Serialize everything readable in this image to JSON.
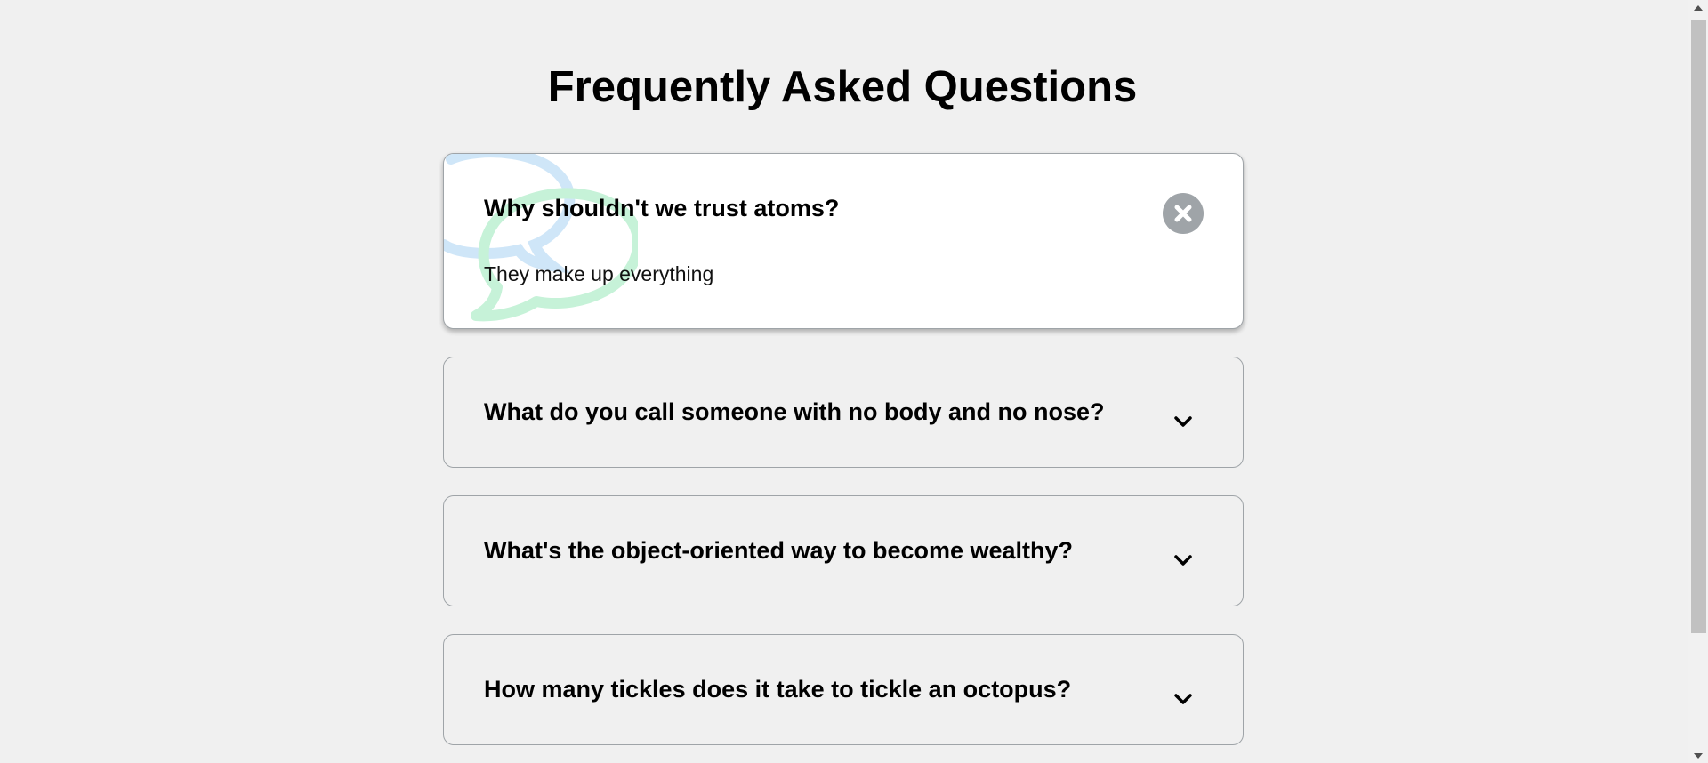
{
  "page": {
    "title": "Frequently Asked Questions"
  },
  "faqs": [
    {
      "question": "Why shouldn't we trust atoms?",
      "answer": "They make up everything",
      "expanded": true
    },
    {
      "question": "What do you call someone with no body and no nose?",
      "answer": "",
      "expanded": false
    },
    {
      "question": "What's the object-oriented way to become wealthy?",
      "answer": "",
      "expanded": false
    },
    {
      "question": "How many tickles does it take to tickle an octopus?",
      "answer": "",
      "expanded": false
    }
  ],
  "icons": {
    "open_toggle": "close-icon",
    "closed_toggle": "chevron-down-icon",
    "decoration": "chat-bubble-icon"
  },
  "colors": {
    "background": "#f0f0f0",
    "card_active": "#ffffff",
    "border": "#9fa4a8",
    "toggle_bg": "#9fa4a8",
    "bubble_blue": "#cfe6f8",
    "bubble_green": "#c6f2d8"
  }
}
